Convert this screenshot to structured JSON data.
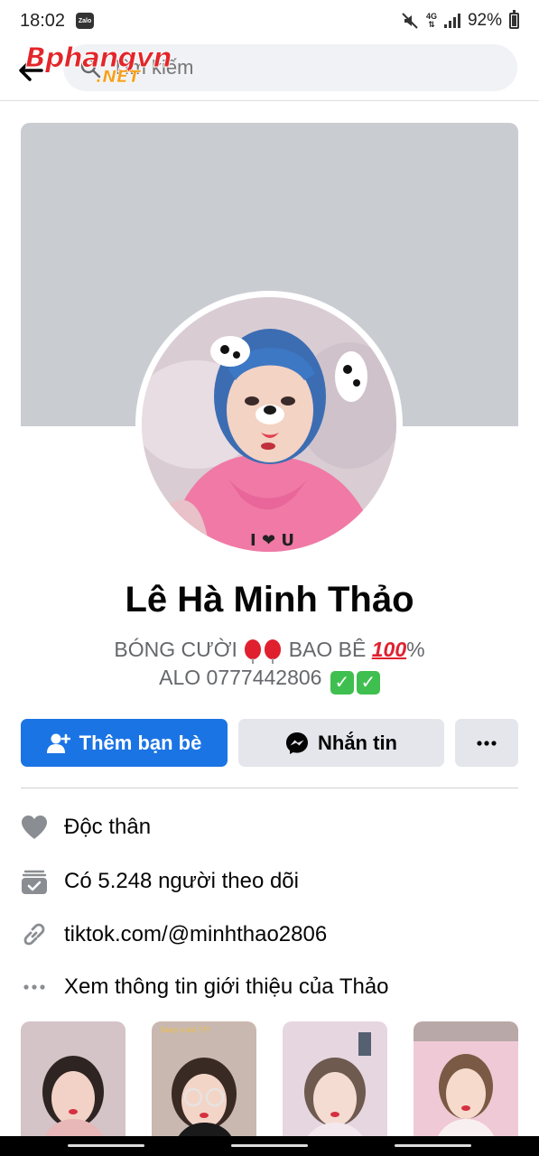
{
  "status_bar": {
    "time": "18:02",
    "app_badge": "Zalo",
    "network": "4G",
    "battery": "92%"
  },
  "search": {
    "placeholder": "Tìm kiếm"
  },
  "watermark": {
    "line1": "Bphangvn",
    "line2": ".NET"
  },
  "profile": {
    "name": "Lê Hà Minh Thảo",
    "bio_part1": "BÓNG CƯỜI",
    "bio_part2": "BAO BÊ",
    "bio_100": "100",
    "bio_percent": "%",
    "bio_line2": "ALO 0777442806"
  },
  "actions": {
    "add_friend": "Thêm bạn bè",
    "message": "Nhắn tin",
    "more": "..."
  },
  "info": {
    "relationship": "Độc thân",
    "followers": "Có 5.248 người theo dõi",
    "link": "tiktok.com/@minhthao2806",
    "see_about": "Xem thông tin giới thiệu của Thảo"
  },
  "photos": [
    {
      "caption": ""
    },
    {
      "caption": "Sexy nuôi ???"
    },
    {
      "caption": ""
    },
    {
      "caption": ""
    }
  ],
  "colors": {
    "primary_blue": "#1b74e4",
    "secondary_gray": "#e4e6eb",
    "cover_gray": "#c9ccd1",
    "muted_text": "#65676b"
  }
}
